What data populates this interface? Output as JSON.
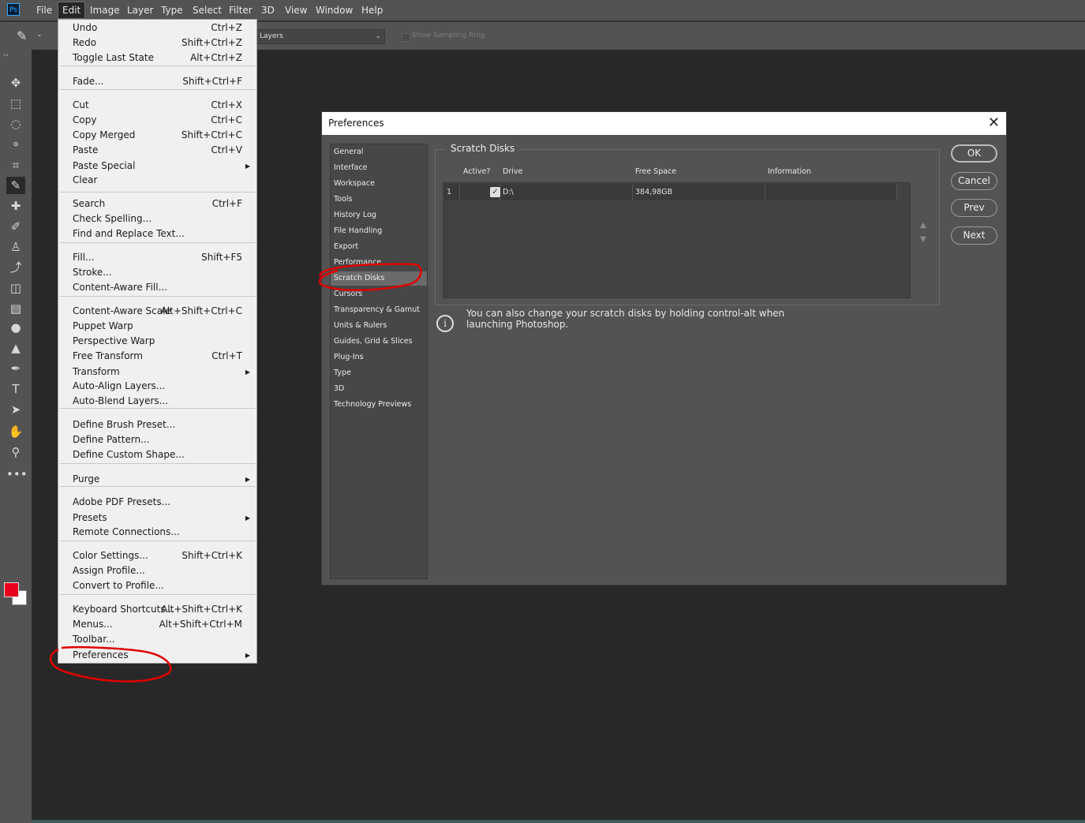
{
  "app": {
    "logo": "Ps"
  },
  "menubar": {
    "items": [
      "File",
      "Edit",
      "Image",
      "Layer",
      "Type",
      "Select",
      "Filter",
      "3D",
      "View",
      "Window",
      "Help"
    ]
  },
  "options_bar": {
    "sample_select_value": "Layers",
    "show_sampling_ring": "Show Sampling Ring",
    "chevron": "⌄"
  },
  "toolbar": {
    "grip": "››",
    "tools": [
      "move-icon",
      "marquee-icon",
      "lasso-icon",
      "quick-select-icon",
      "crop-icon",
      "eyedropper-icon",
      "healing-icon",
      "brush-icon",
      "clone-stamp-icon",
      "history-brush-icon",
      "eraser-icon",
      "gradient-icon",
      "blur-icon",
      "dodge-icon",
      "pen-icon",
      "type-icon",
      "path-select-icon",
      "hand-icon",
      "zoom-icon",
      "more-icon"
    ],
    "glyphs": [
      "✥",
      "⬚",
      "◌",
      "⚬",
      "⌗",
      "✎",
      "✚",
      "✐",
      "♙",
      "⤴",
      "◫",
      "▤",
      "●",
      "▲",
      "✒",
      "T",
      "➤",
      "✋",
      "⚲",
      "•••"
    ],
    "fg_color": "#e8001c",
    "bg_color": "#ffffff"
  },
  "edit_menu": {
    "items": [
      {
        "label": "Undo",
        "shortcut": "Ctrl+Z"
      },
      {
        "label": "Redo",
        "shortcut": "Shift+Ctrl+Z"
      },
      {
        "label": "Toggle Last State",
        "shortcut": "Alt+Ctrl+Z"
      },
      {
        "label": "Fade...",
        "shortcut": "Shift+Ctrl+F"
      },
      {
        "label": "Cut",
        "shortcut": "Ctrl+X"
      },
      {
        "label": "Copy",
        "shortcut": "Ctrl+C"
      },
      {
        "label": "Copy Merged",
        "shortcut": "Shift+Ctrl+C"
      },
      {
        "label": "Paste",
        "shortcut": "Ctrl+V"
      },
      {
        "label": "Paste Special",
        "shortcut": "",
        "submenu": true
      },
      {
        "label": "Clear",
        "shortcut": ""
      },
      {
        "label": "Search",
        "shortcut": "Ctrl+F"
      },
      {
        "label": "Check Spelling...",
        "shortcut": ""
      },
      {
        "label": "Find and Replace Text...",
        "shortcut": ""
      },
      {
        "label": "Fill...",
        "shortcut": "Shift+F5"
      },
      {
        "label": "Stroke...",
        "shortcut": ""
      },
      {
        "label": "Content-Aware Fill...",
        "shortcut": ""
      },
      {
        "label": "Content-Aware Scale",
        "shortcut": "Alt+Shift+Ctrl+C"
      },
      {
        "label": "Puppet Warp",
        "shortcut": ""
      },
      {
        "label": "Perspective Warp",
        "shortcut": ""
      },
      {
        "label": "Free Transform",
        "shortcut": "Ctrl+T"
      },
      {
        "label": "Transform",
        "shortcut": "",
        "submenu": true
      },
      {
        "label": "Auto-Align Layers...",
        "shortcut": ""
      },
      {
        "label": "Auto-Blend Layers...",
        "shortcut": ""
      },
      {
        "label": "Define Brush Preset...",
        "shortcut": ""
      },
      {
        "label": "Define Pattern...",
        "shortcut": ""
      },
      {
        "label": "Define Custom Shape...",
        "shortcut": ""
      },
      {
        "label": "Purge",
        "shortcut": "",
        "submenu": true
      },
      {
        "label": "Adobe PDF Presets...",
        "shortcut": ""
      },
      {
        "label": "Presets",
        "shortcut": "",
        "submenu": true
      },
      {
        "label": "Remote Connections...",
        "shortcut": ""
      },
      {
        "label": "Color Settings...",
        "shortcut": "Shift+Ctrl+K"
      },
      {
        "label": "Assign Profile...",
        "shortcut": ""
      },
      {
        "label": "Convert to Profile...",
        "shortcut": ""
      },
      {
        "label": "Keyboard Shortcuts...",
        "shortcut": "Alt+Shift+Ctrl+K"
      },
      {
        "label": "Menus...",
        "shortcut": "Alt+Shift+Ctrl+M"
      },
      {
        "label": "Toolbar...",
        "shortcut": ""
      },
      {
        "label": "Preferences",
        "shortcut": "",
        "submenu": true
      }
    ]
  },
  "preferences": {
    "title": "Preferences",
    "close": "✕",
    "categories": [
      "General",
      "Interface",
      "Workspace",
      "Tools",
      "History Log",
      "File Handling",
      "Export",
      "Performance",
      "Scratch Disks",
      "Cursors",
      "Transparency & Gamut",
      "Units & Rulers",
      "Guides, Grid & Slices",
      "Plug-Ins",
      "Type",
      "3D",
      "Technology Previews"
    ],
    "selected_category": "Scratch Disks",
    "section_title": "Scratch Disks",
    "columns": [
      "Active?",
      "Drive",
      "Free Space",
      "Information"
    ],
    "rows": [
      {
        "index": "1",
        "active": "✓",
        "drive": "D:\\",
        "free_space": "384,98GB",
        "information": ""
      }
    ],
    "arrow_up": "▲",
    "arrow_down": "▼",
    "buttons": {
      "ok": "OK",
      "cancel": "Cancel",
      "prev": "Prev",
      "next": "Next"
    },
    "info_icon": "i",
    "info_text": "You can also change your scratch disks by holding control-alt when launching Photoshop."
  }
}
